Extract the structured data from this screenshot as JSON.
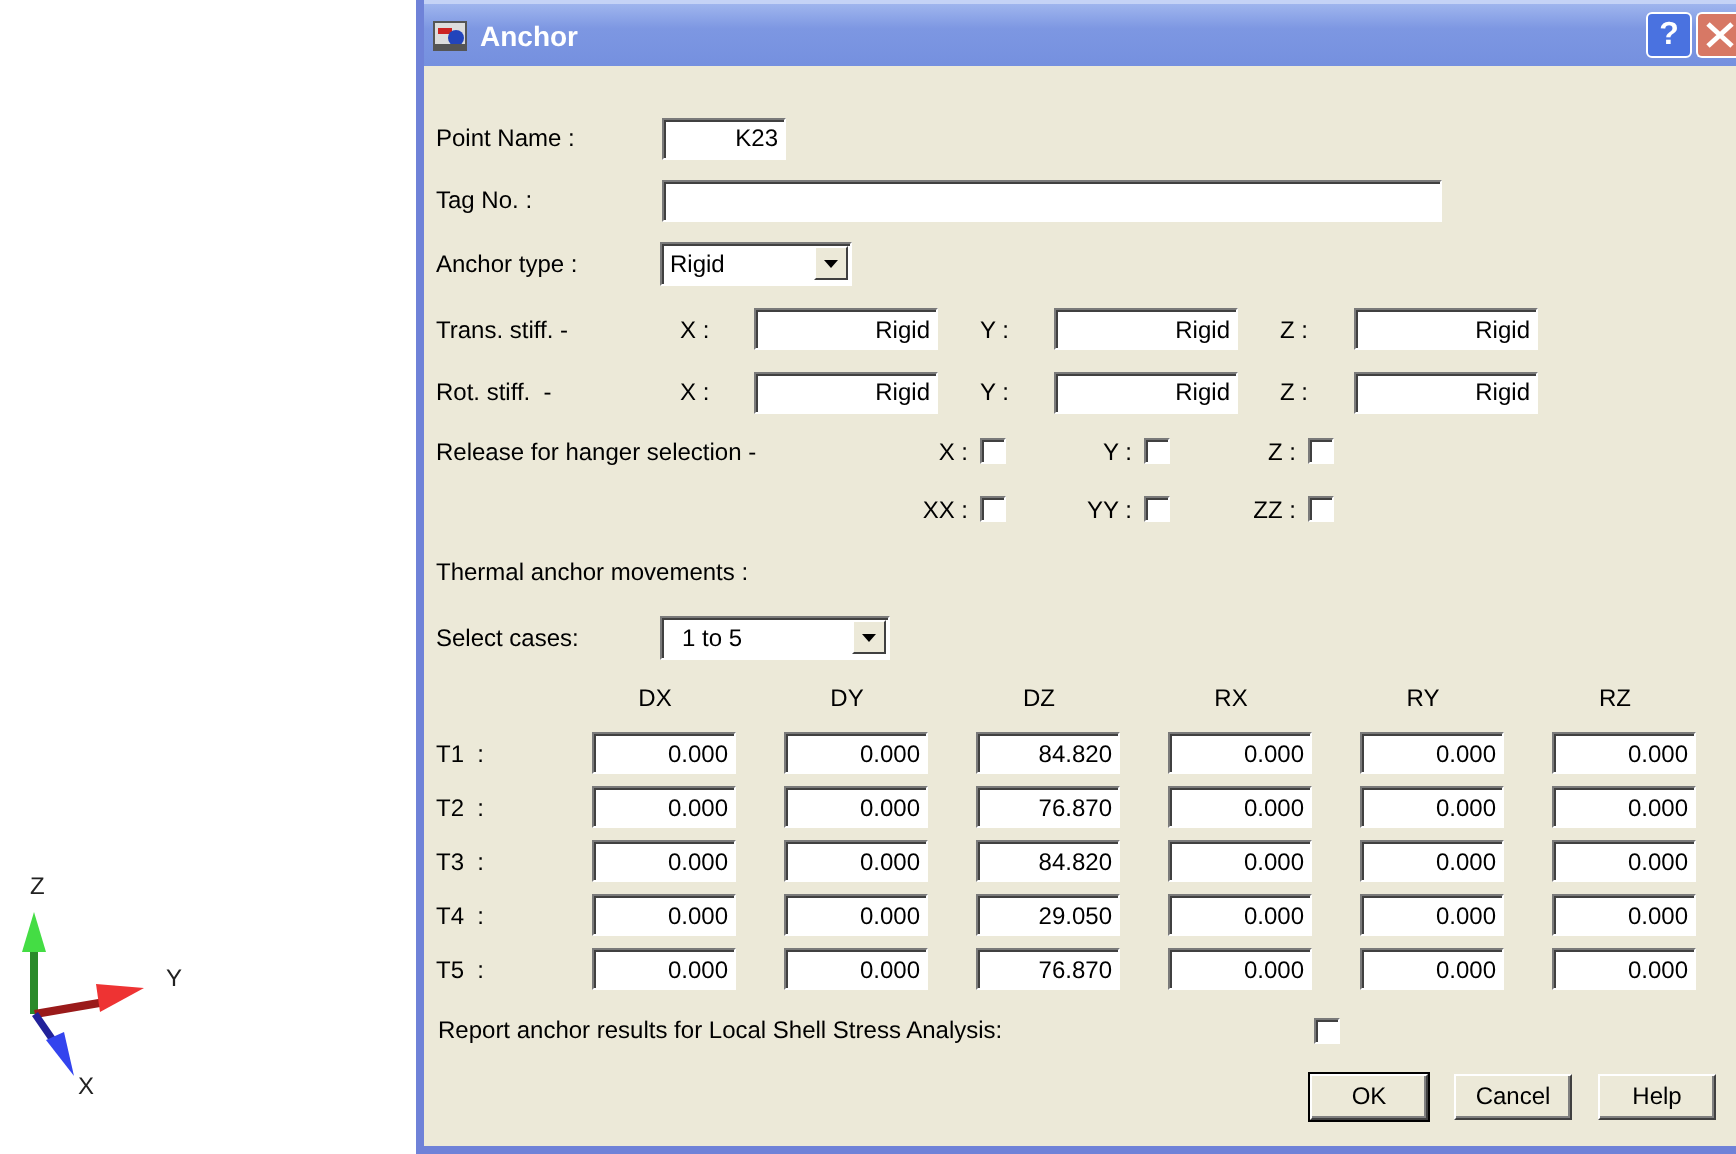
{
  "axes": {
    "z_label": "Z",
    "y_label": "Y",
    "x_label": "X"
  },
  "window": {
    "title": "Anchor",
    "help_button": "?"
  },
  "point_name": {
    "label": "Point Name :",
    "value": "K23"
  },
  "tag_no": {
    "label": "Tag No. :"
  },
  "anchor_type": {
    "label": "Anchor type :",
    "value": "Rigid"
  },
  "stiffness_rows": [
    {
      "label": "Trans. stiff. -",
      "fields": [
        {
          "axis": "X :",
          "value": "Rigid"
        },
        {
          "axis": "Y :",
          "value": "Rigid"
        },
        {
          "axis": "Z :",
          "value": "Rigid"
        }
      ]
    },
    {
      "label": "Rot. stiff.  -",
      "fields": [
        {
          "axis": "X :",
          "value": "Rigid"
        },
        {
          "axis": "Y :",
          "value": "Rigid"
        },
        {
          "axis": "Z :",
          "value": "Rigid"
        }
      ]
    }
  ],
  "release": {
    "label": "Release for hanger selection -",
    "checks": [
      {
        "label": "X :",
        "checked": false
      },
      {
        "label": "Y :",
        "checked": false
      },
      {
        "label": "Z :",
        "checked": false
      },
      {
        "label": "XX :",
        "checked": false
      },
      {
        "label": "YY :",
        "checked": false
      },
      {
        "label": "ZZ :",
        "checked": false
      }
    ]
  },
  "thermal": {
    "label": "Thermal anchor movements :",
    "select_label": "Select cases:",
    "select_value": "1 to 5",
    "columns": [
      "DX",
      "DY",
      "DZ",
      "RX",
      "RY",
      "RZ"
    ],
    "rows": [
      {
        "label": "T1  :",
        "values": [
          "0.000",
          "0.000",
          "84.820",
          "0.000",
          "0.000",
          "0.000"
        ]
      },
      {
        "label": "T2  :",
        "values": [
          "0.000",
          "0.000",
          "76.870",
          "0.000",
          "0.000",
          "0.000"
        ]
      },
      {
        "label": "T3  :",
        "values": [
          "0.000",
          "0.000",
          "84.820",
          "0.000",
          "0.000",
          "0.000"
        ]
      },
      {
        "label": "T4  :",
        "values": [
          "0.000",
          "0.000",
          "29.050",
          "0.000",
          "0.000",
          "0.000"
        ]
      },
      {
        "label": "T5  :",
        "values": [
          "0.000",
          "0.000",
          "76.870",
          "0.000",
          "0.000",
          "0.000"
        ]
      }
    ]
  },
  "report": {
    "label": "Report anchor results for Local Shell Stress Analysis:",
    "checked": false
  },
  "buttons": [
    {
      "label": "OK",
      "default": true
    },
    {
      "label": "Cancel",
      "default": false
    },
    {
      "label": "Help",
      "default": false
    }
  ]
}
